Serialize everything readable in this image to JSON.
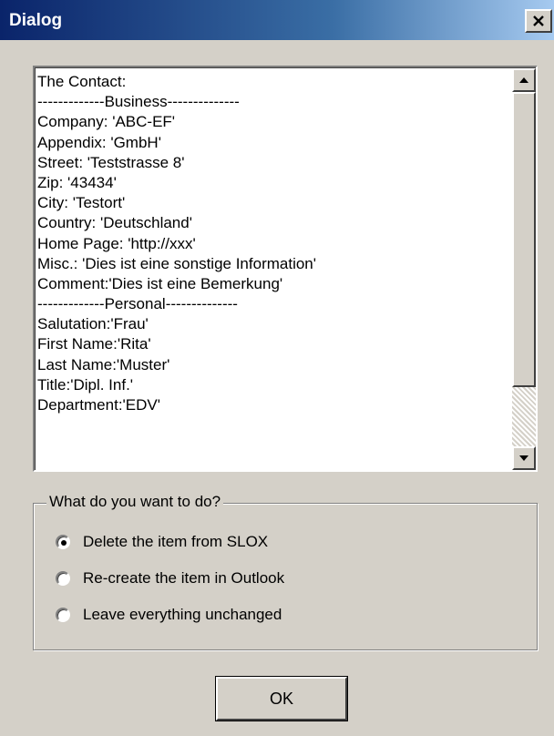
{
  "window": {
    "title": "Dialog",
    "close_glyph": "✕",
    "close_icon": "close-icon"
  },
  "contact_list": {
    "lines": [
      "The Contact:",
      "-------------Business--------------",
      "Company: 'ABC-EF'",
      "Appendix: 'GmbH'",
      "Street: 'Teststrasse 8'",
      "Zip: '43434'",
      "City: 'Testort'",
      "Country: 'Deutschland'",
      "Home Page: 'http://xxx'",
      "Misc.: 'Dies ist eine sonstige Information'",
      "Comment:'Dies ist eine Bemerkung'",
      "-------------Personal--------------",
      "Salutation:'Frau'",
      "First Name:'Rita'",
      "Last Name:'Muster'",
      "Title:'Dipl. Inf.'",
      "Department:'EDV'"
    ],
    "scroll_up_icon": "scroll-up-arrow-icon",
    "scroll_down_icon": "scroll-down-arrow-icon"
  },
  "choice_group": {
    "title": "What do you want to do?",
    "options": [
      {
        "label": "Delete the item from SLOX",
        "checked": true
      },
      {
        "label": "Re-create the item in Outlook",
        "checked": false
      },
      {
        "label": "Leave everything unchanged",
        "checked": false
      }
    ]
  },
  "buttons": {
    "ok_label": "OK"
  },
  "colors": {
    "titlebar_start": "#0a246a",
    "titlebar_end": "#a6caf0",
    "face": "#d4d0c8"
  }
}
